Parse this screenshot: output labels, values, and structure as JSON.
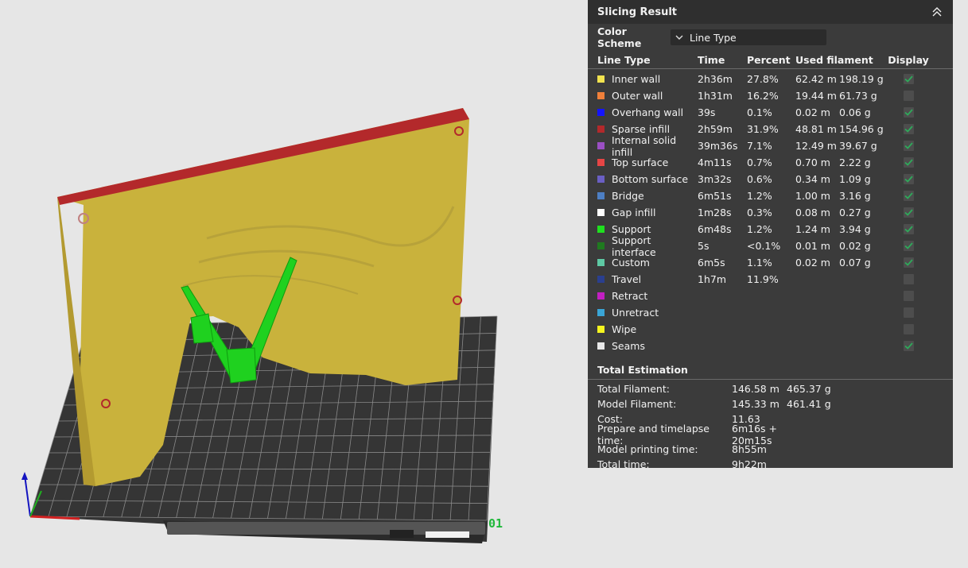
{
  "panel": {
    "title": "Slicing Result",
    "color_scheme_label": "Color Scheme",
    "color_scheme_value": "Line Type",
    "headers": {
      "type": "Line Type",
      "time": "Time",
      "percent": "Percent",
      "used": "Used filament",
      "display": "Display"
    },
    "rows": [
      {
        "name": "Inner wall",
        "color": "#f2e34f",
        "time": "2h36m",
        "percent": "27.8%",
        "length": "62.42 m",
        "weight": "198.19 g",
        "checked": true
      },
      {
        "name": "Outer wall",
        "color": "#f0803a",
        "time": "1h31m",
        "percent": "16.2%",
        "length": "19.44 m",
        "weight": "61.73 g",
        "checked": false
      },
      {
        "name": "Overhang wall",
        "color": "#1414ff",
        "time": "39s",
        "percent": "0.1%",
        "length": "0.02 m",
        "weight": "0.06 g",
        "checked": true
      },
      {
        "name": "Sparse infill",
        "color": "#b3292b",
        "time": "2h59m",
        "percent": "31.9%",
        "length": "48.81 m",
        "weight": "154.96 g",
        "checked": true
      },
      {
        "name": "Internal solid infill",
        "color": "#9b4fc4",
        "time": "39m36s",
        "percent": "7.1%",
        "length": "12.49 m",
        "weight": "39.67 g",
        "checked": true
      },
      {
        "name": "Top surface",
        "color": "#e64545",
        "time": "4m11s",
        "percent": "0.7%",
        "length": "0.70 m",
        "weight": "2.22 g",
        "checked": true
      },
      {
        "name": "Bottom surface",
        "color": "#6a5fc4",
        "time": "3m32s",
        "percent": "0.6%",
        "length": "0.34 m",
        "weight": "1.09 g",
        "checked": true
      },
      {
        "name": "Bridge",
        "color": "#4d7fc4",
        "time": "6m51s",
        "percent": "1.2%",
        "length": "1.00 m",
        "weight": "3.16 g",
        "checked": true
      },
      {
        "name": "Gap infill",
        "color": "#ffffff",
        "time": "1m28s",
        "percent": "0.3%",
        "length": "0.08 m",
        "weight": "0.27 g",
        "checked": true
      },
      {
        "name": "Support",
        "color": "#1fe01f",
        "time": "6m48s",
        "percent": "1.2%",
        "length": "1.24 m",
        "weight": "3.94 g",
        "checked": true
      },
      {
        "name": "Support interface",
        "color": "#1f7a1f",
        "time": "5s",
        "percent": "<0.1%",
        "length": "0.01 m",
        "weight": "0.02 g",
        "checked": true
      },
      {
        "name": "Custom",
        "color": "#5ec9a4",
        "time": "6m5s",
        "percent": "1.1%",
        "length": "0.02 m",
        "weight": "0.07 g",
        "checked": true
      },
      {
        "name": "Travel",
        "color": "#2a3f8f",
        "time": "1h7m",
        "percent": "11.9%",
        "length": "",
        "weight": "",
        "checked": false
      },
      {
        "name": "Retract",
        "color": "#c21fc2",
        "time": "",
        "percent": "",
        "length": "",
        "weight": "",
        "checked": false
      },
      {
        "name": "Unretract",
        "color": "#3aa5d6",
        "time": "",
        "percent": "",
        "length": "",
        "weight": "",
        "checked": false
      },
      {
        "name": "Wipe",
        "color": "#f5f51f",
        "time": "",
        "percent": "",
        "length": "",
        "weight": "",
        "checked": false
      },
      {
        "name": "Seams",
        "color": "#e8e8e8",
        "time": "",
        "percent": "",
        "length": "",
        "weight": "",
        "checked": true
      }
    ],
    "totals_title": "Total Estimation",
    "totals": [
      {
        "label": "Total Filament:",
        "v1": "146.58 m",
        "v2": "465.37 g"
      },
      {
        "label": "Model Filament:",
        "v1": "145.33 m",
        "v2": "461.41 g"
      },
      {
        "label": "Cost:",
        "v1": "11.63",
        "v2": ""
      },
      {
        "label": "Prepare and timelapse time:",
        "v1": "6m16s + 20m15s",
        "v2": ""
      },
      {
        "label": "Model printing time:",
        "v1": "8h55m",
        "v2": ""
      },
      {
        "label": "Total time:",
        "v1": "9h22m",
        "v2": ""
      }
    ]
  },
  "viewport": {
    "plate_number": "01"
  },
  "colors": {
    "panel_bg": "#3b3b3b",
    "header_bg": "#2f2f2f",
    "check": "#2eaa5a",
    "model": "#c9b23c",
    "top_edge": "#b3292b",
    "support": "#1fd11f",
    "bed": "#3d3d3d"
  }
}
